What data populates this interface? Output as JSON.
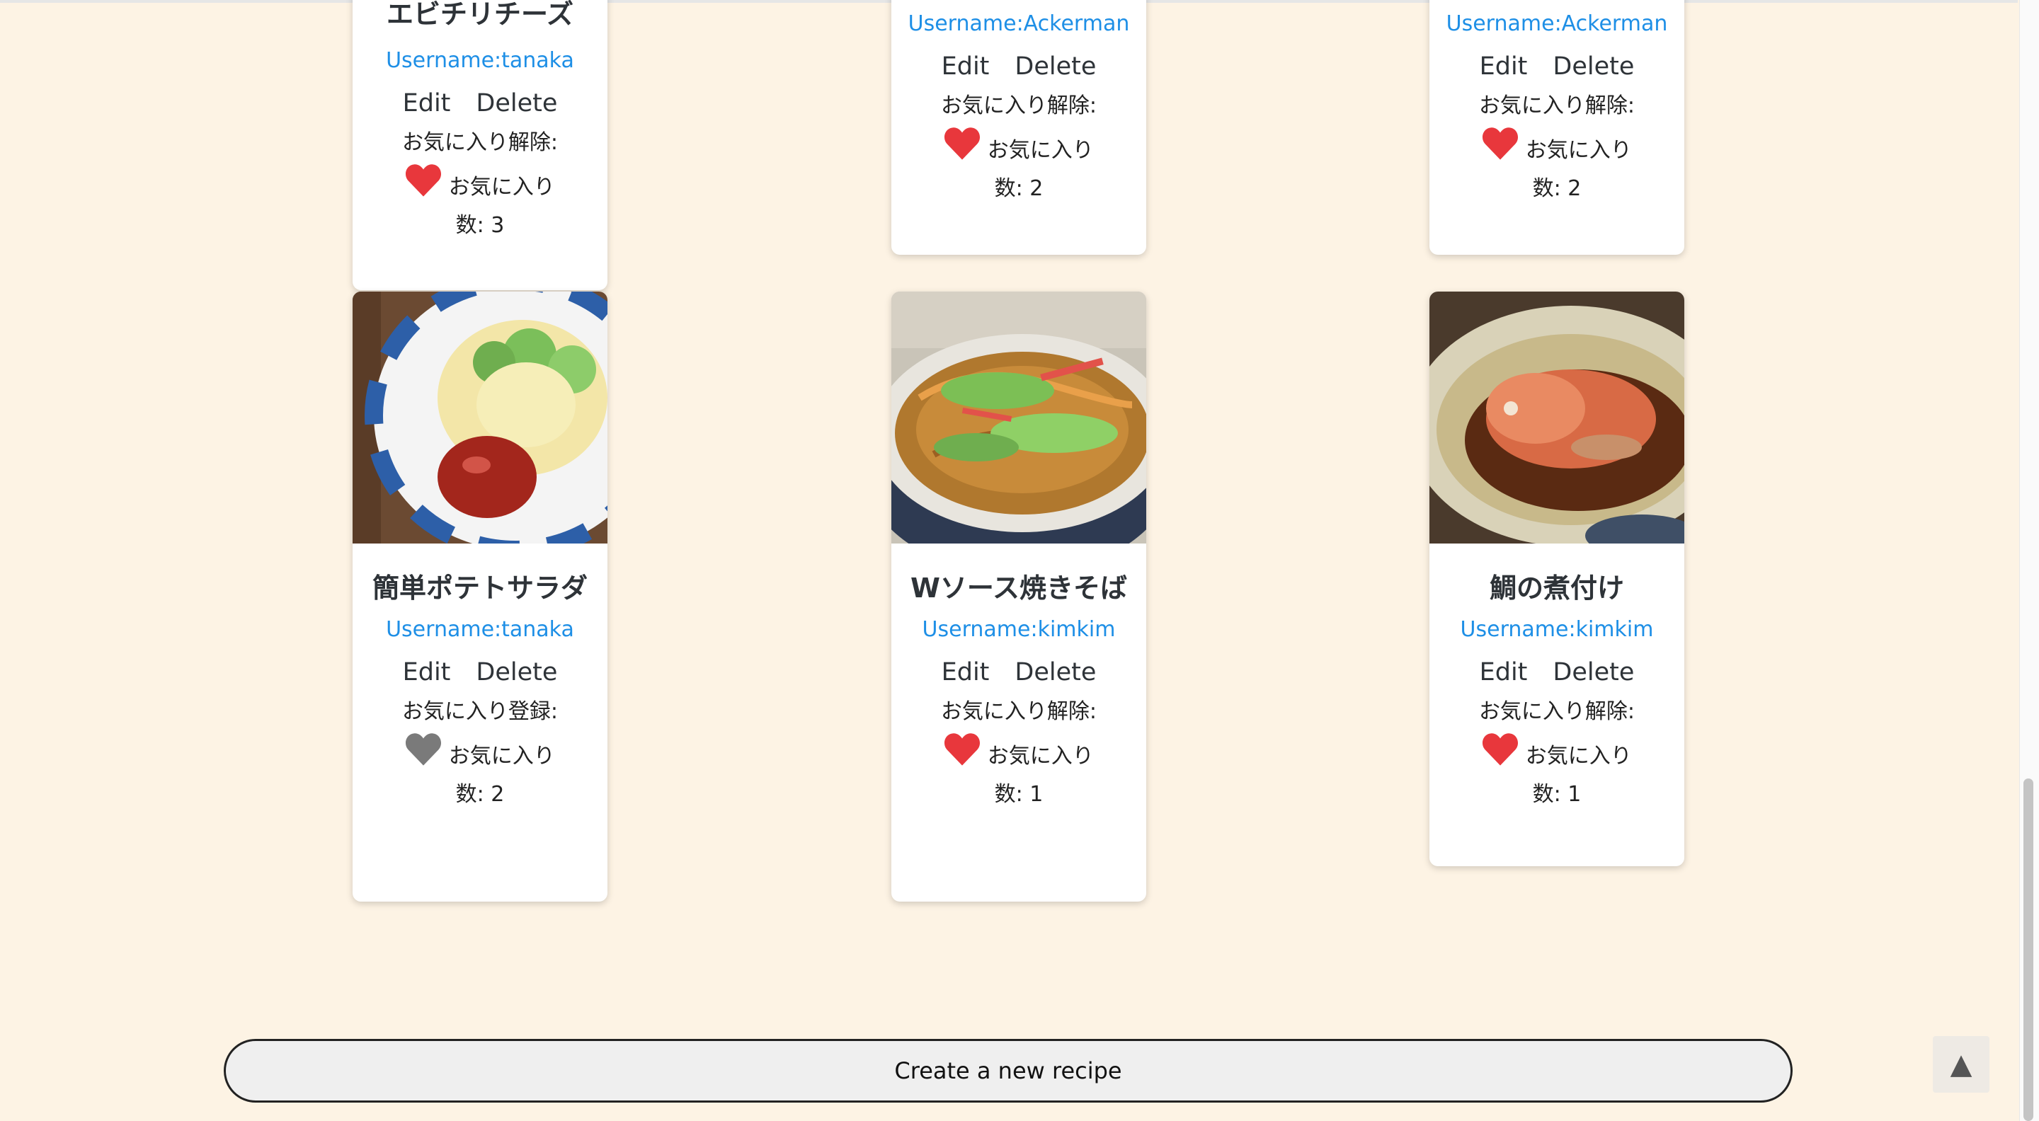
{
  "cards_top": [
    {
      "title": "エビチリチーズ",
      "username": "Username:tanaka",
      "edit": "Edit",
      "delete": "Delete",
      "fav_action": "お気に入り解除:",
      "fav_count_label": "お気に入り数: 3",
      "favorited": true
    },
    {
      "username": "Username:Ackerman",
      "edit": "Edit",
      "delete": "Delete",
      "fav_action": "お気に入り解除:",
      "fav_count_label": "お気に入り数: 2",
      "favorited": true
    },
    {
      "username": "Username:Ackerman",
      "edit": "Edit",
      "delete": "Delete",
      "fav_action": "お気に入り解除:",
      "fav_count_label": "お気に入り数: 2",
      "favorited": true
    }
  ],
  "cards_bottom": [
    {
      "title": "簡単ポテトサラダ",
      "username": "Username:tanaka",
      "edit": "Edit",
      "delete": "Delete",
      "fav_action": "お気に入り登録:",
      "fav_count_label": "お気に入り数: 2",
      "favorited": false
    },
    {
      "title": "Wソース焼きそば",
      "username": "Username:kimkim",
      "edit": "Edit",
      "delete": "Delete",
      "fav_action": "お気に入り解除:",
      "fav_count_label": "お気に入り数: 1",
      "favorited": true
    },
    {
      "title": "鯛の煮付け",
      "username": "Username:kimkim",
      "edit": "Edit",
      "delete": "Delete",
      "fav_action": "お気に入り解除:",
      "fav_count_label": "お気に入り数: 1",
      "favorited": true
    }
  ],
  "create_button": "Create a new recipe",
  "scroll_top_icon": "▲",
  "colors": {
    "background": "#fdf3e4",
    "username_link": "#1e8fe6",
    "heart_active": "#e8373c",
    "heart_inactive": "#7a7a7a"
  }
}
